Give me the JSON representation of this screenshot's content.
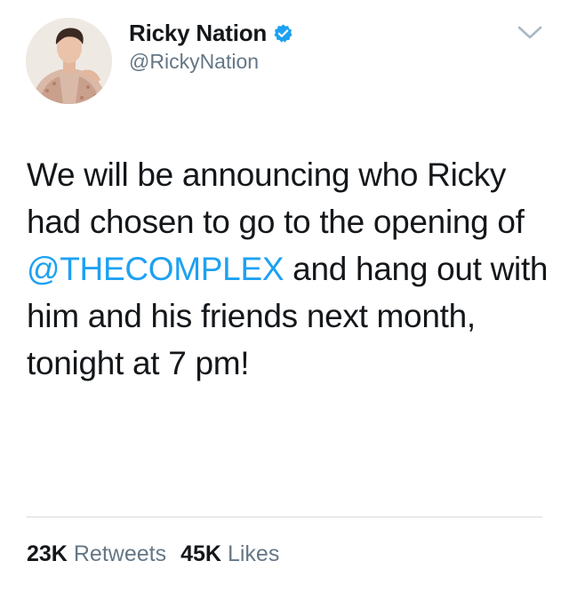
{
  "user": {
    "display_name": "Ricky Nation",
    "handle": "@RickyNation",
    "verified": true
  },
  "tweet": {
    "text_before": "We will be announcing who Ricky had chosen to go to the opening of ",
    "mention": "@THECOMPLEX",
    "text_after": " and hang out with him and his friends next month, tonight at 7 pm!"
  },
  "stats": {
    "retweets_count": "23K",
    "retweets_label": "Retweets",
    "likes_count": "45K",
    "likes_label": "Likes"
  },
  "colors": {
    "mention": "#1da1f2",
    "verified_badge": "#1da1f2",
    "secondary_text": "#657786"
  },
  "icons": {
    "verified": "verified-badge-icon",
    "menu": "chevron-down-icon"
  }
}
